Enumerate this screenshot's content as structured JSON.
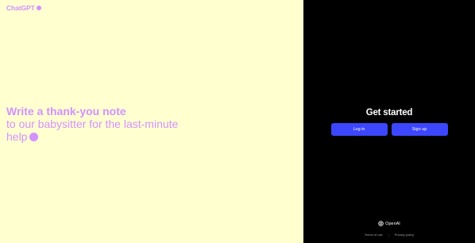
{
  "brand": {
    "name": "ChatGPT",
    "color": "#d292ff"
  },
  "prompt": {
    "line1": "Write a thank-you note",
    "line2": "to our babysitter for the last-minute",
    "line3": "help"
  },
  "auth": {
    "title": "Get started",
    "login_label": "Log in",
    "signup_label": "Sign up",
    "button_color": "#3c46ff"
  },
  "footer": {
    "brand": "OpenAI",
    "terms": "Terms of use",
    "separator": "|",
    "privacy": "Privacy policy"
  },
  "colors": {
    "left_bg": "#ffffd0",
    "right_bg": "#000000"
  },
  "icons": {
    "brand_dot": "brand-dot-icon",
    "openai_logo": "openai-logo-icon",
    "cursor": "cursor-dot-icon"
  }
}
